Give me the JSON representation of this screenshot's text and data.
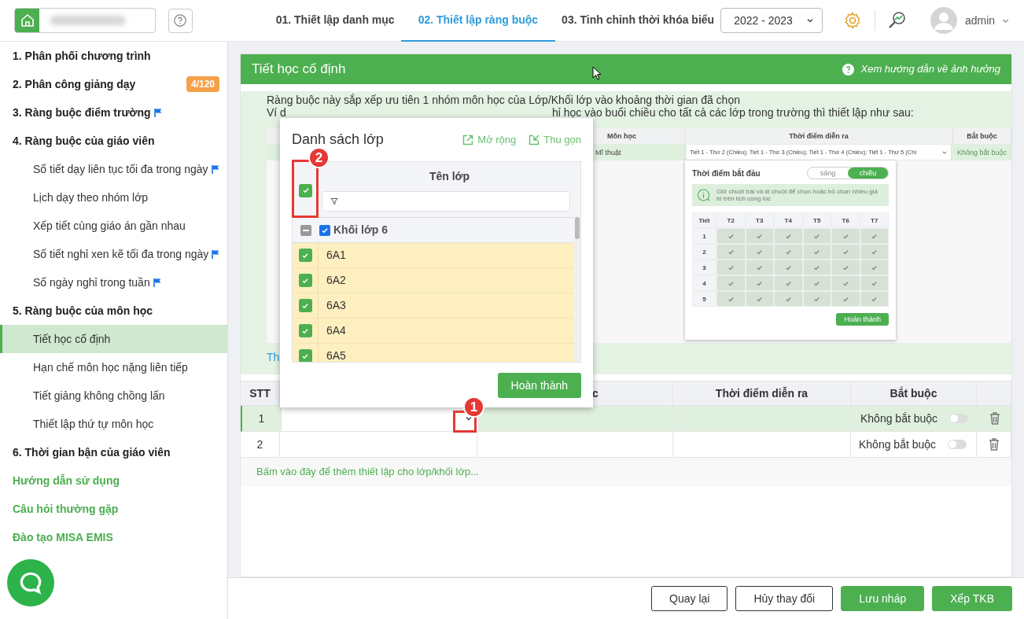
{
  "topbar": {
    "tabs": [
      {
        "label": "01. Thiết lập danh mục",
        "selected": false
      },
      {
        "label": "02. Thiết lập ràng buộc",
        "selected": true
      },
      {
        "label": "03. Tinh chỉnh thời khóa biểu",
        "selected": false
      }
    ],
    "year": "2022 - 2023",
    "user": "admin"
  },
  "sidebar": {
    "items": [
      {
        "label": "1. Phân phối chương trình",
        "selected": false,
        "flag": false
      },
      {
        "label": "2. Phân công giảng dạy",
        "selected": false,
        "flag": false,
        "badge": "4/120"
      },
      {
        "label": "3. Ràng buộc điểm trường",
        "selected": false,
        "flag": true
      },
      {
        "label": "4. Ràng buộc của giáo viên",
        "selected": false,
        "flag": false,
        "children": [
          {
            "label": "Số tiết dạy liên tục tối đa trong ngày",
            "selected": false,
            "flag": true
          },
          {
            "label": "Lịch dạy theo nhóm lớp",
            "selected": false,
            "flag": false
          },
          {
            "label": "Xếp tiết cùng giáo án gần nhau",
            "selected": false,
            "flag": false
          },
          {
            "label": "Số tiết nghỉ xen kẽ tối đa trong ngày",
            "selected": false,
            "flag": true
          },
          {
            "label": "Số ngày nghỉ trong tuần",
            "selected": false,
            "flag": true
          }
        ]
      },
      {
        "label": "5. Ràng buộc của môn học",
        "selected": false,
        "flag": false,
        "children": [
          {
            "label": "Tiết học cố định",
            "selected": true,
            "flag": false
          },
          {
            "label": "Hạn chế môn học nặng liên tiếp",
            "selected": false,
            "flag": false
          },
          {
            "label": "Tiết giảng không chồng lấn",
            "selected": false,
            "flag": false
          },
          {
            "label": "Thiết lập thứ tự môn học",
            "selected": false,
            "flag": false
          }
        ]
      },
      {
        "label": "6. Thời gian bận của giáo viên",
        "selected": false,
        "flag": false
      }
    ],
    "links": [
      "Hướng dẫn sử dụng",
      "Câu hỏi thường gặp",
      "Đào tạo MISA EMIS"
    ]
  },
  "panel": {
    "title": "Tiết học cố định",
    "help_link": "Xem hướng dẫn về ảnh hưởng",
    "help": {
      "line_1": "Ràng buộc này sắp xếp ưu tiên 1 nhóm môn học của Lớp/Khối lớp vào khoảng thời gian đã chọn",
      "line_2_start": "Ví d",
      "line_2_end": "hỉ học vào buổi chiều cho tất cả các lớp trong trường thì thiết lập như sau:",
      "link_fragment": "Th"
    },
    "example": {
      "columns": [
        "Môn học",
        "Thời điểm diễn ra",
        "Bắt buộc"
      ],
      "row": {
        "subject": "Mĩ thuật",
        "time": "Tiết 1 - Thứ 2 (Chiều); Tiết 1 - Thứ 3 (Chiều); Tiết 1 - Thứ 4 (Chiều); Tiết 1 - Thứ 5 (Chi",
        "required": "Không bắt buộc"
      },
      "picker": {
        "title": "Thời điểm bắt đầu",
        "sessions": [
          {
            "label": "sáng",
            "selected": false
          },
          {
            "label": "chiều",
            "selected": true
          }
        ],
        "hint": "Giữ chuột trái và di chuột để chọn hoặc bỏ chọn nhiều giá trị trên lịch cùng lúc",
        "corner": "Tiết",
        "days": [
          "T2",
          "T3",
          "T4",
          "T5",
          "T6",
          "T7"
        ],
        "periods": [
          {
            "label": "1",
            "cells": [
              true,
              true,
              true,
              true,
              true,
              true
            ]
          },
          {
            "label": "2",
            "cells": [
              true,
              true,
              true,
              true,
              true,
              true
            ]
          },
          {
            "label": "3",
            "cells": [
              true,
              true,
              true,
              true,
              true,
              true
            ]
          },
          {
            "label": "4",
            "cells": [
              true,
              true,
              true,
              true,
              true,
              true
            ]
          },
          {
            "label": "5",
            "cells": [
              true,
              true,
              true,
              true,
              true,
              true
            ]
          }
        ],
        "button": "Hoàn thành"
      }
    }
  },
  "table": {
    "header": {
      "stt": "STT",
      "column_3": "c",
      "time": "Thời điểm diễn ra",
      "required": "Bắt buộc"
    },
    "rows": [
      {
        "stt": "1",
        "selected": true,
        "required_label": "Không bắt buộc",
        "on": false
      },
      {
        "stt": "2",
        "selected": false,
        "required_label": "Không bắt buộc",
        "on": false
      }
    ],
    "add_link": "Bấm vào đây để thêm thiết lập cho lớp/khối lớp..."
  },
  "popup": {
    "title": "Danh sách lớp",
    "actions": [
      "Mở rộng",
      "Thu gọn"
    ],
    "column": "Tên lớp",
    "all_checked": true,
    "group": {
      "label": "Khối lớp 6",
      "checked": true,
      "expanded": true
    },
    "classes": [
      {
        "name": "6A1",
        "checked": true
      },
      {
        "name": "6A2",
        "checked": true
      },
      {
        "name": "6A3",
        "checked": true
      },
      {
        "name": "6A4",
        "checked": true
      },
      {
        "name": "6A5",
        "checked": true
      }
    ],
    "button": "Hoàn thành"
  },
  "callouts": [
    {
      "label": "1"
    },
    {
      "label": "2"
    }
  ],
  "footer": {
    "buttons": [
      {
        "label": "Quay lại",
        "kind": "outline"
      },
      {
        "label": "Hủy thay đổi",
        "kind": "outline"
      },
      {
        "label": "Lưu nháp",
        "kind": "primary"
      },
      {
        "label": "Xếp TKB",
        "kind": "primary"
      }
    ]
  }
}
